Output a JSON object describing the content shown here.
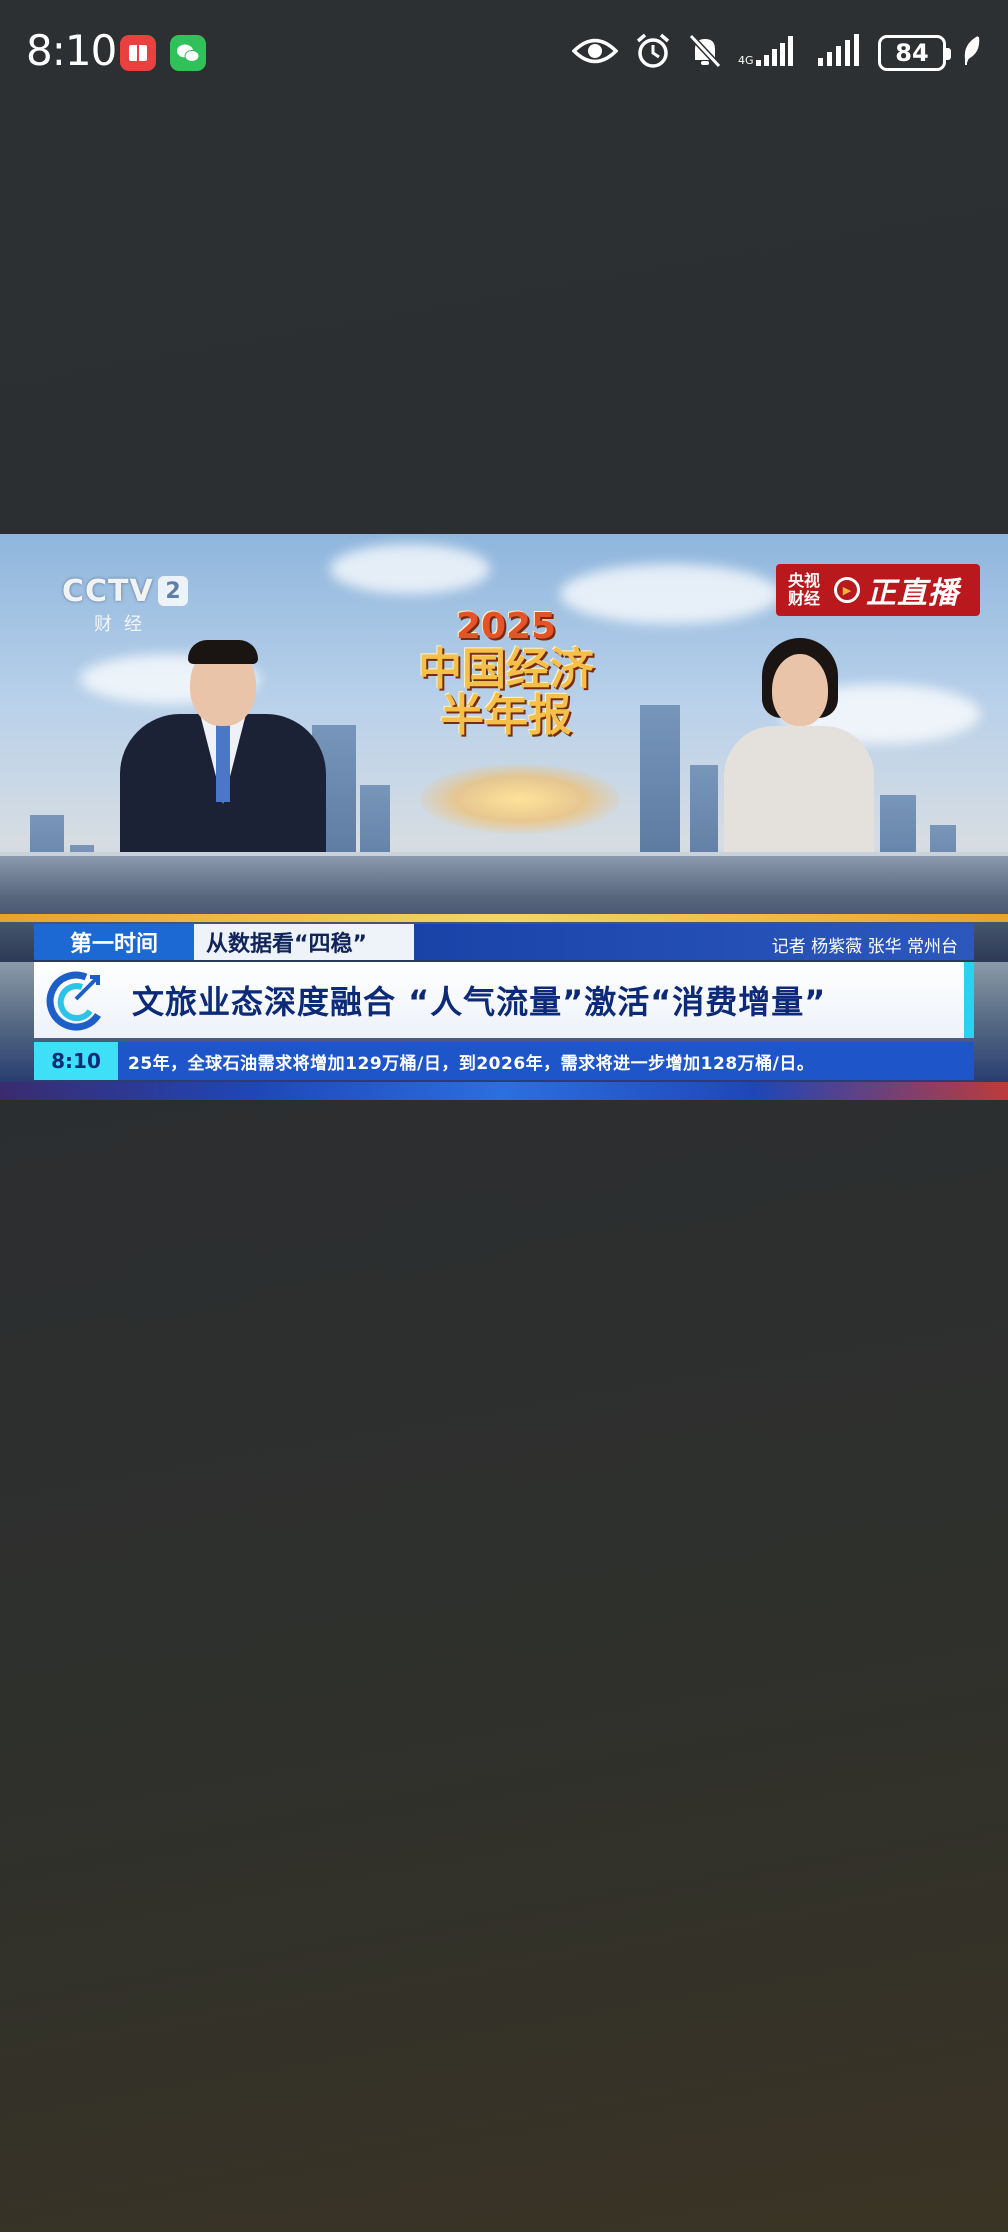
{
  "status_bar": {
    "time": "8:10",
    "battery": "84",
    "apps": [
      "notification-app-icon",
      "wechat-icon"
    ],
    "indicators": [
      "eye-icon",
      "alarm-icon",
      "bell-muted-icon",
      "signal-1-icon",
      "signal-2-icon",
      "leaf-icon"
    ]
  },
  "video": {
    "channel_logo": "CCTV",
    "channel_number": "2",
    "channel_sub": "财经",
    "show_year": "2025",
    "show_title_line1": "中国经济",
    "show_title_line2": "半年报",
    "live_badge": {
      "brand_line1": "央视",
      "brand_line2": "财经",
      "label": "正直播"
    },
    "lower_third": {
      "program": "第一时间",
      "segment": "从数据看“四稳”",
      "reporter": "记者 杨紫薇 张华 常州台",
      "headline": "文旅业态深度融合 “人气流量”激活“消费增量”",
      "clock": "8:10",
      "ticker": "25年，全球石油需求将增加129万桶/日，到2026年，需求将进一步增加128万桶/日。"
    },
    "colors": {
      "program_bg": "#1c69d4",
      "headline_text": "#0c2a78",
      "ticker_bg": "#1e55c8",
      "clock_bg": "#3fe0f7",
      "live_bg": "#b9191c"
    }
  }
}
